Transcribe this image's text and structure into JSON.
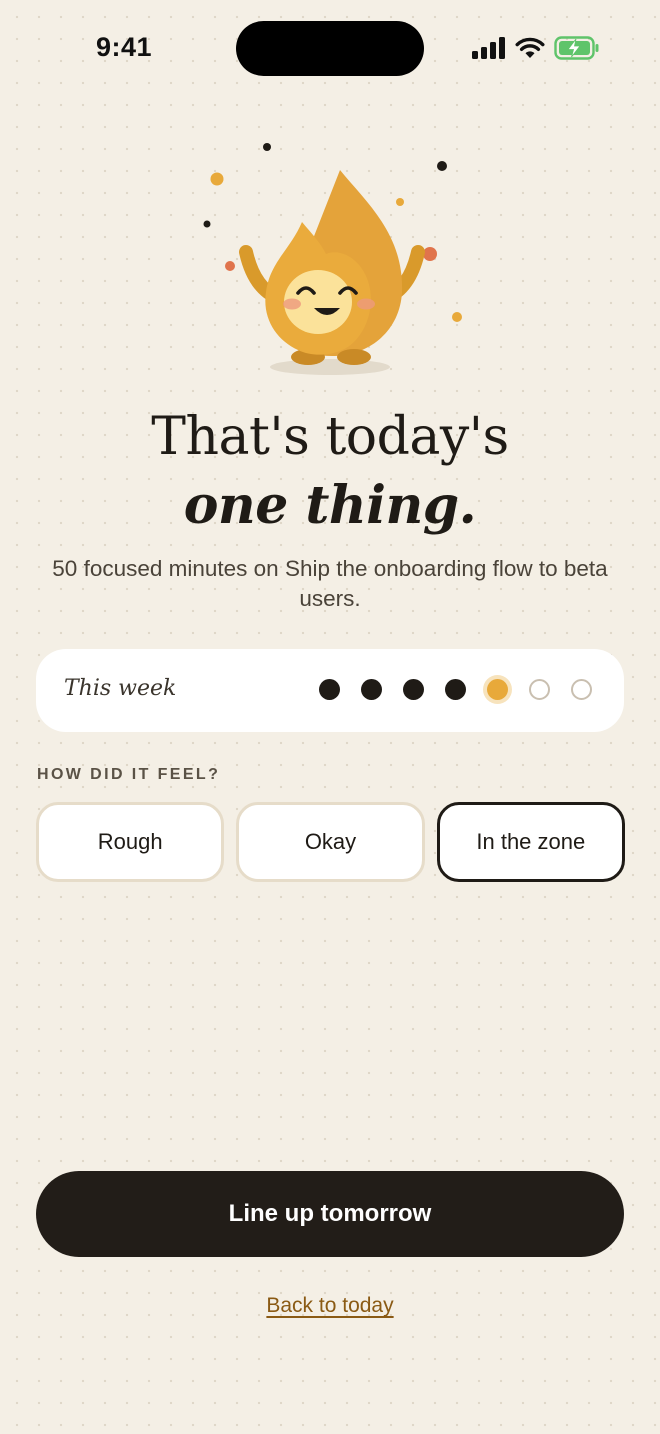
{
  "status_bar": {
    "time": "9:41"
  },
  "headline": {
    "line1": "That's today's",
    "line2": "one thing."
  },
  "summary": "50 focused minutes on Ship the onboarding flow to beta users.",
  "week": {
    "label": "This week",
    "days": [
      "done",
      "done",
      "done",
      "done",
      "today",
      "future",
      "future"
    ]
  },
  "feel": {
    "label": "HOW DID IT FEEL?",
    "options": [
      "Rough",
      "Okay",
      "In the zone"
    ],
    "selected": "In the zone"
  },
  "actions": {
    "primary_label": "Line up tomorrow",
    "back_label": "Back to today"
  },
  "colors": {
    "background": "#f4efe5",
    "accent": "#e8a93a",
    "ink": "#1f1b16",
    "link": "#8a5a14"
  }
}
